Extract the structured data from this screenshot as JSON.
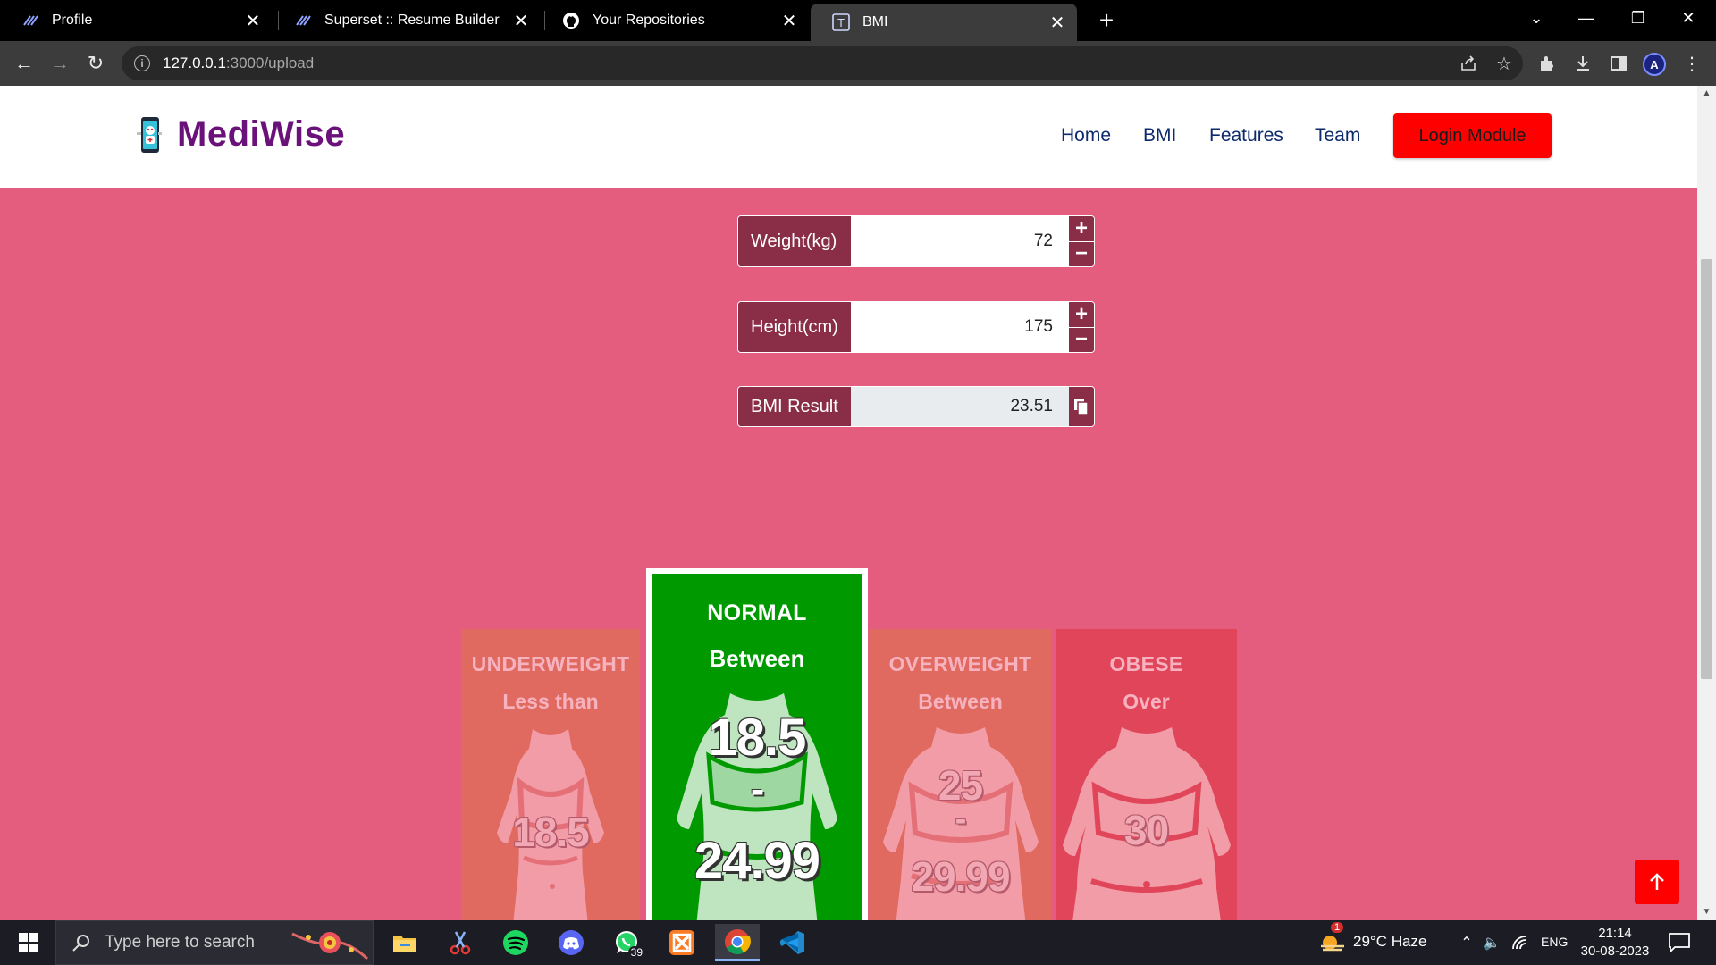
{
  "browser": {
    "tabs": [
      {
        "title": "Profile",
        "icon": "superset-icon"
      },
      {
        "title": "Superset :: Resume Builder",
        "icon": "superset-icon"
      },
      {
        "title": "Your Repositories",
        "icon": "github-icon"
      },
      {
        "title": "BMI",
        "icon": "bmi-t-icon",
        "active": true
      }
    ],
    "url_host": "127.0.0.1",
    "url_path": ":3000/upload"
  },
  "site": {
    "brand": "MediWise",
    "nav": [
      "Home",
      "BMI",
      "Features",
      "Team"
    ],
    "login_button": "Login Module"
  },
  "form": {
    "weight_label": "Weight(kg)",
    "weight_value": "72",
    "height_label": "Height(cm)",
    "height_value": "175",
    "result_label": "BMI Result",
    "result_value": "23.51"
  },
  "categories": [
    {
      "title": "UNDERWEIGHT",
      "sub": "Less than",
      "num1": "18.5",
      "num2": "",
      "highlighted": false,
      "color": "#e06a60"
    },
    {
      "title": "NORMAL",
      "sub": "Between",
      "num1": "18.5",
      "dash": "-",
      "num2": "24.99",
      "highlighted": true,
      "color": "#009a00"
    },
    {
      "title": "OVERWEIGHT",
      "sub": "Between",
      "num1": "25",
      "dash": "-",
      "num2": "29.99",
      "highlighted": false,
      "color": "#e06a60"
    },
    {
      "title": "OBESE",
      "sub": "Over",
      "num1": "30",
      "num2": "",
      "highlighted": false,
      "color": "#e04559"
    }
  ],
  "taskbar": {
    "search_placeholder": "Type here to search",
    "whatsapp_badge": "39",
    "weather": "29°C  Haze",
    "weather_badge": "1",
    "language": "ENG",
    "time": "21:14",
    "date": "30-08-2023"
  },
  "colors": {
    "page_bg": "#e45c7e",
    "brand": "#6b127a",
    "nav": "#0d2a6a",
    "accent_red": "#ff0000",
    "label_bg": "#8a2d47",
    "normal_green": "#009a00"
  }
}
